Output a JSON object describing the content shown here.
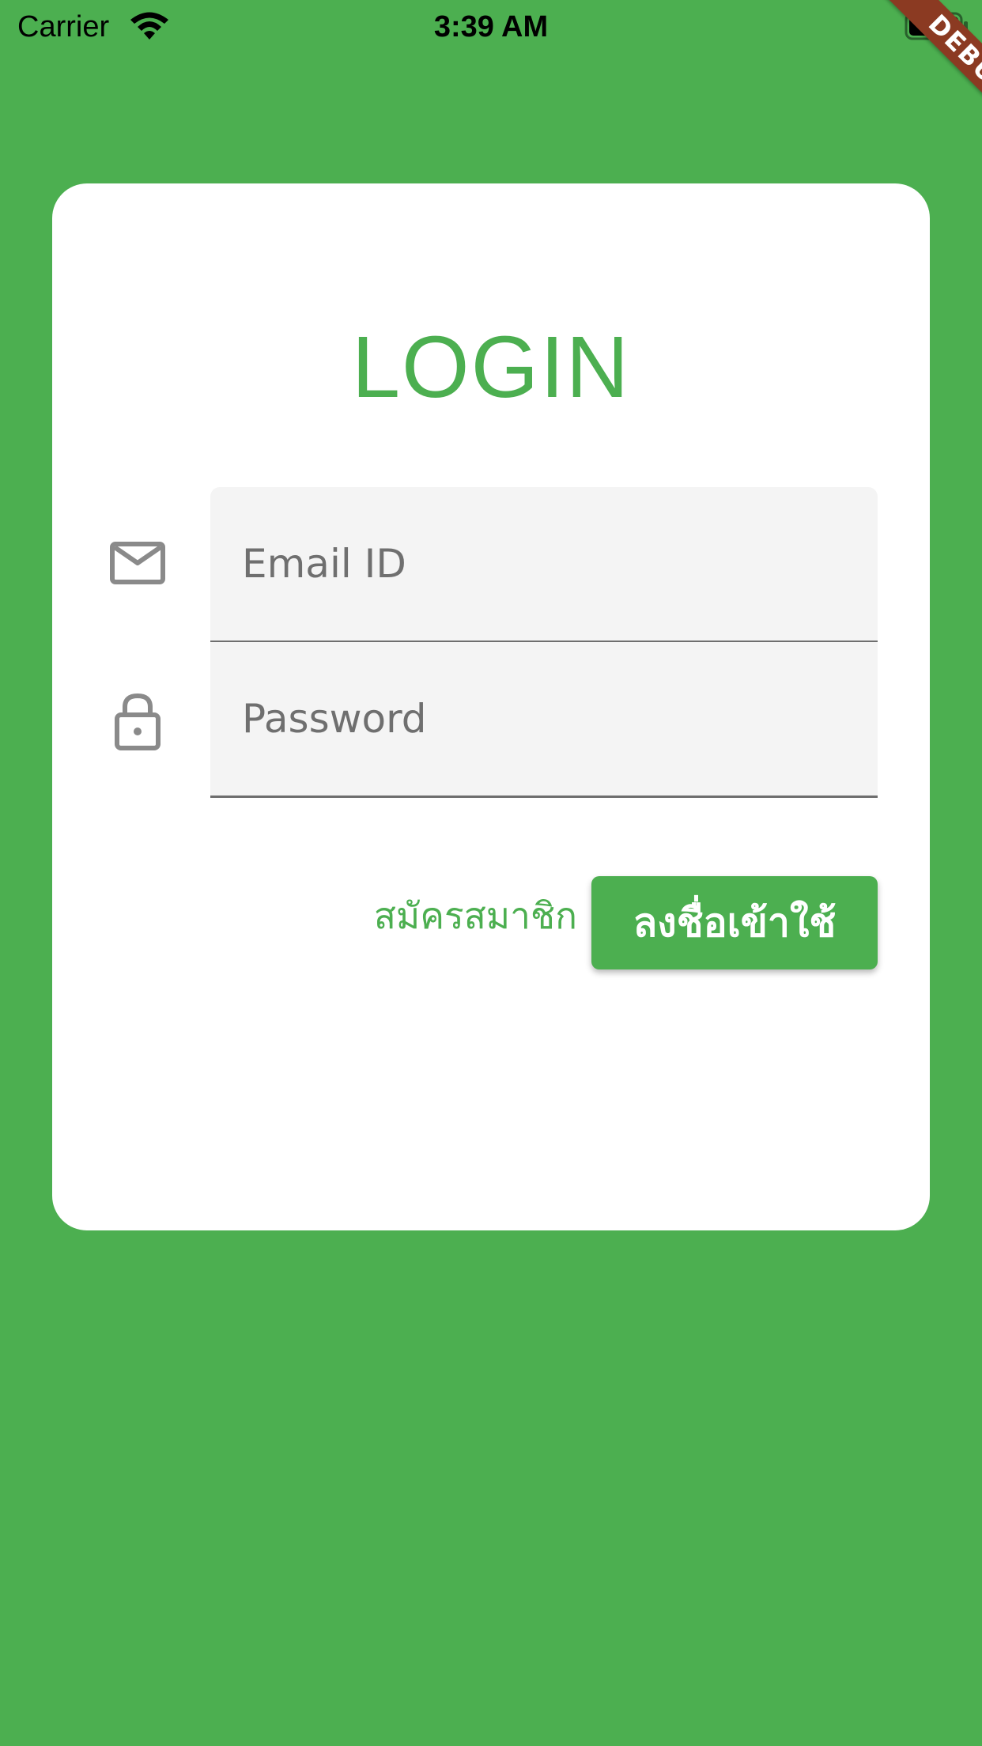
{
  "status_bar": {
    "carrier": "Carrier",
    "time": "3:39 AM"
  },
  "debug_banner": {
    "label": "DEBUG",
    "color": "#8b3a22"
  },
  "theme": {
    "primary": "#4caf50",
    "card_background": "#ffffff",
    "field_background": "#f4f4f4",
    "icon_color": "#8a8a8a"
  },
  "login_form": {
    "title": "LOGIN",
    "email": {
      "icon": "mail-icon",
      "placeholder": "Email ID",
      "value": ""
    },
    "password": {
      "icon": "lock-icon",
      "placeholder": "Password",
      "value": ""
    },
    "register_label": "สมัครสมาชิก",
    "login_label": "ลงชื่อเข้าใช้"
  }
}
